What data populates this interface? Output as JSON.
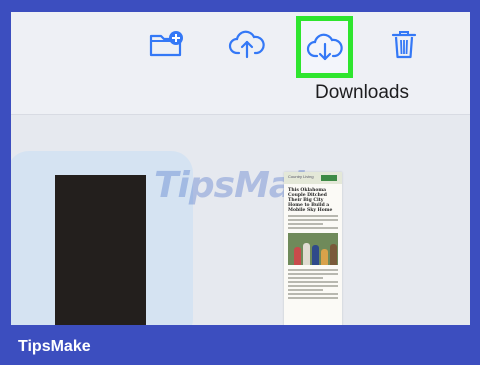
{
  "toolbar": {
    "buttons": [
      {
        "name": "new-folder",
        "icon": "folder-plus-icon"
      },
      {
        "name": "upload",
        "icon": "cloud-upload-icon"
      },
      {
        "name": "downloads",
        "icon": "cloud-download-icon",
        "highlighted": true
      },
      {
        "name": "delete",
        "icon": "trash-icon"
      }
    ],
    "downloads_label": "Downloads"
  },
  "content": {
    "watermark": "TipsMake",
    "document_preview": {
      "title": "This Oklahoma Couple Ditched Their Big City Home to Build a Mobile Sky Home",
      "header": "Country Living"
    }
  },
  "footer": {
    "brand": "TipsMake"
  },
  "colors": {
    "frame": "#3c4ebf",
    "screen_bg": "#eef0f5",
    "icon_blue": "#3478f6",
    "highlight_green": "#2ee52e",
    "card": "#d5e3f2"
  }
}
